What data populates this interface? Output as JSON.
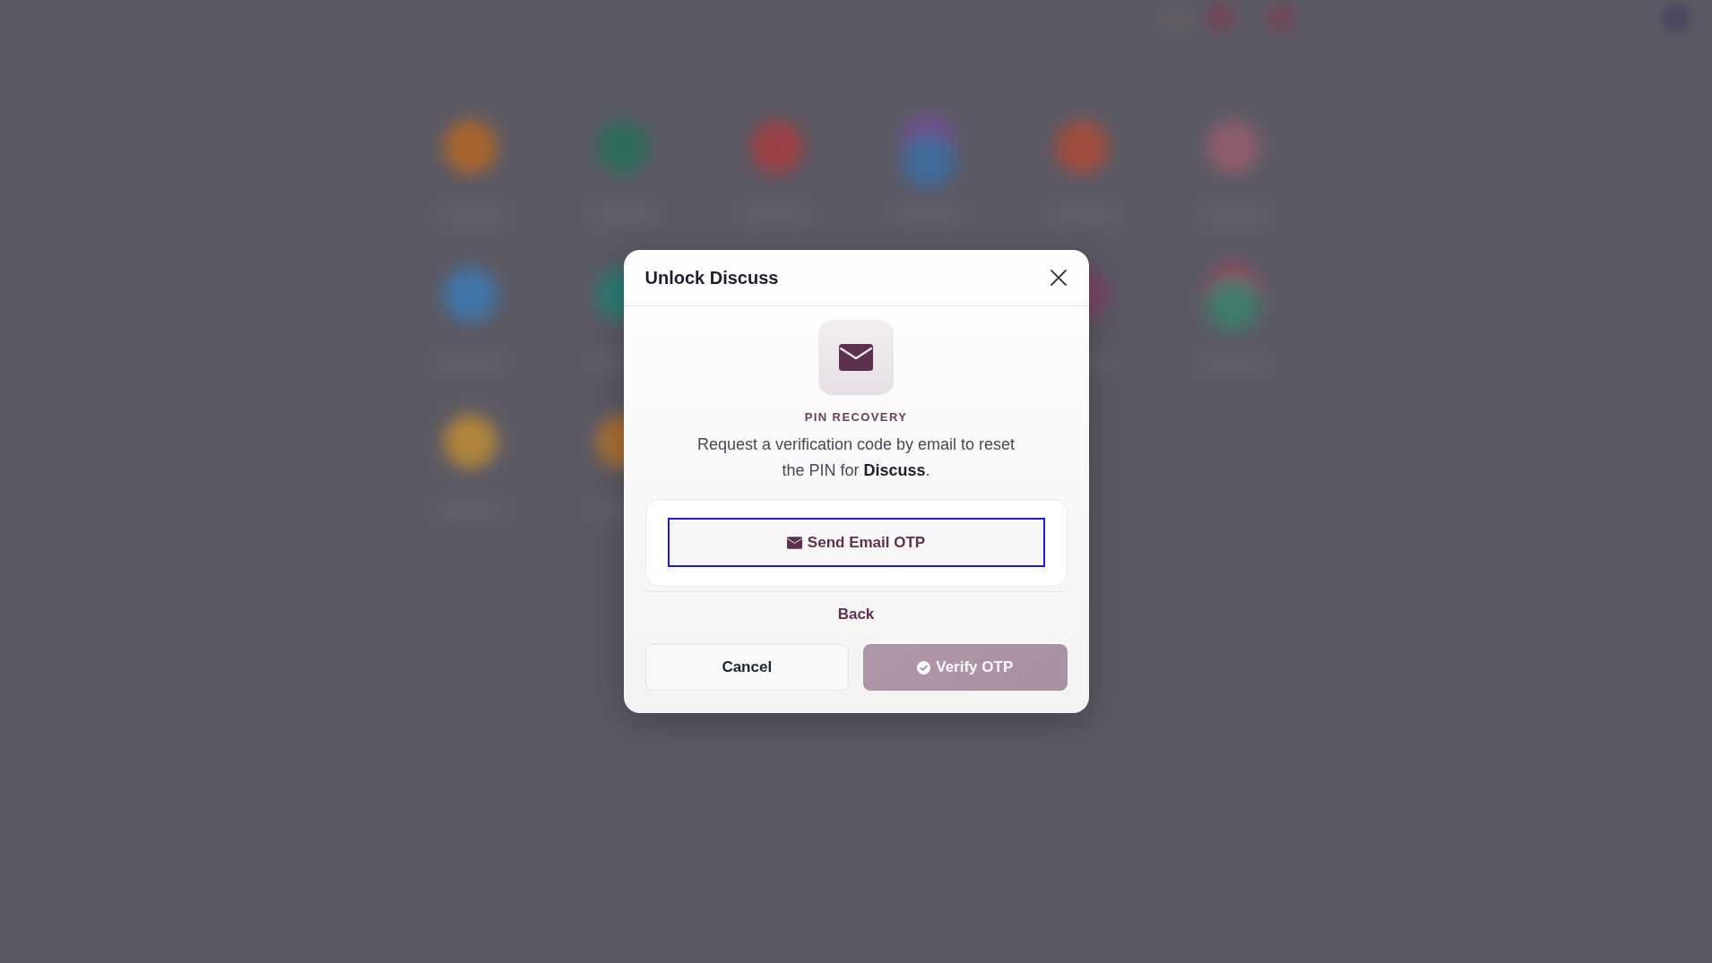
{
  "dialog": {
    "title": "Unlock Discuss",
    "section_label": "PIN RECOVERY",
    "description": "Request a verification code by email to reset the PIN for **Discuss**.",
    "send_button": {
      "label": "Send Email OTP",
      "focused": true
    },
    "back_link": "Back",
    "buttons": [
      {
        "label": "Cancel",
        "kind": "secondary",
        "disabled": false
      },
      {
        "label": "Verify OTP",
        "kind": "primary",
        "disabled": true
      }
    ]
  }
}
